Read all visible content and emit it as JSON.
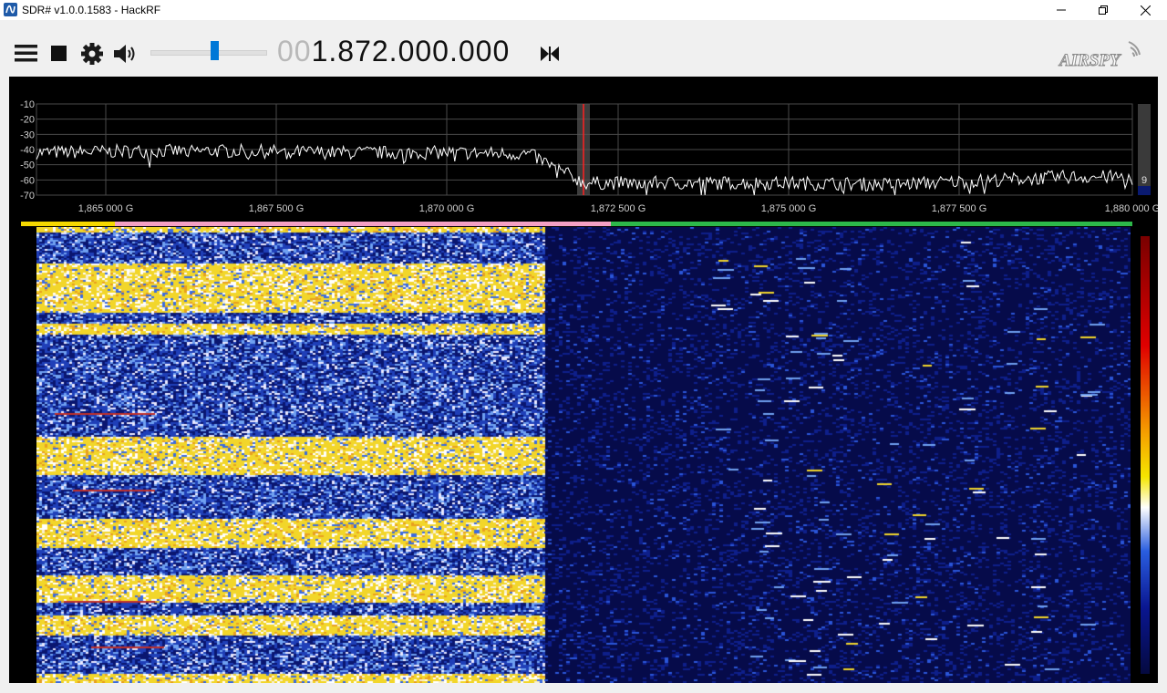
{
  "window": {
    "title": "SDR# v1.0.0.1583 - HackRF",
    "controls": {
      "minimize": "—",
      "restore": "❐",
      "close": "✕"
    }
  },
  "toolbar": {
    "menu_icon": "hamburger-menu-icon",
    "stop_icon": "stop-icon",
    "settings_icon": "gear-icon",
    "volume_icon": "speaker-icon",
    "volume_level": 0.55,
    "frequency_leading": "00",
    "frequency_main": "1.872.000.000",
    "tune_icon": "tune-to-center-icon",
    "logo_text": "AIRSPY"
  },
  "colors": {
    "accent": "#0078d7",
    "spectrum_bg": "#000000",
    "grid": "#4a4a4a",
    "trace": "#ffffff",
    "tuning_line": "#ff2020",
    "band_yellow": "#f5d800",
    "band_pink": "#f4a0c4",
    "band_green": "#2db84a",
    "waterfall_low": "#060b4a",
    "waterfall_high": "#f5dc2a"
  },
  "spectrum": {
    "y_ticks": [
      "-10",
      "-20",
      "-30",
      "-40",
      "-50",
      "-60",
      "-70"
    ],
    "x_ticks": [
      "1,865 000 G",
      "1,867 500 G",
      "1,870 000 G",
      "1,872 500 G",
      "1,875 000 G",
      "1,877 500 G",
      "1,880 000 G"
    ],
    "level_value": "9",
    "db_range": [
      -70,
      -10
    ],
    "freq_range_ghz": [
      1.864,
      1.88
    ],
    "tuned_freq_ghz": 1.872
  },
  "chart_data": {
    "type": "line",
    "x": [
      1.864,
      1.8655,
      1.867,
      1.8685,
      1.87,
      1.8712,
      1.872,
      1.8735,
      1.875,
      1.8765,
      1.878,
      1.879,
      1.88
    ],
    "series": [
      {
        "values": [
          -42,
          -41,
          -41,
          -42,
          -42,
          -43,
          -62,
          -62,
          -62,
          -63,
          -60,
          -58,
          -58
        ]
      }
    ],
    "xlabel": "",
    "ylabel": "",
    "ylim": [
      -70,
      -10
    ],
    "xlim": [
      1.864,
      1.88
    ],
    "grid": true
  }
}
